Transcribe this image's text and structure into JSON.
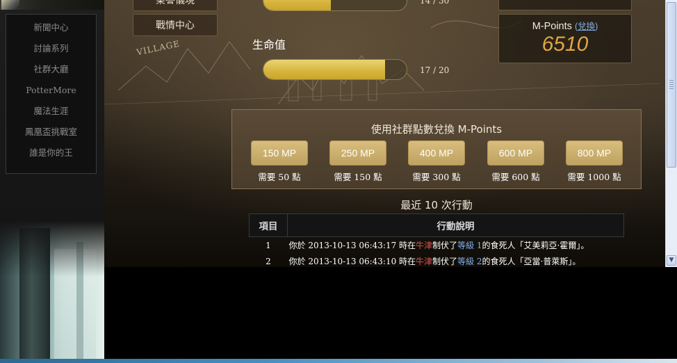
{
  "left_nav": {
    "items": [
      "新聞中心",
      "討論系列",
      "社群大廳",
      "PotterMore",
      "魔法生涯",
      "鳳凰盃挑戰室",
      "誰是你的王"
    ]
  },
  "buttons": {
    "top_partial": "榮譽儀現",
    "battle_center": "戰情中心"
  },
  "bars": {
    "top_text": "14 / 30",
    "top_fraction": 0.47,
    "life_label": "生命值",
    "life_text": "17 / 20",
    "life_fraction": 0.85
  },
  "mpoints": {
    "title": "M-Points",
    "link_open": "(",
    "link": "兌換",
    "link_close": ")",
    "value": "6510"
  },
  "exchange": {
    "title": "使用社群點數兌換 M-Points",
    "options": [
      {
        "label": "150 MP",
        "note": "需要 50 點"
      },
      {
        "label": "250 MP",
        "note": "需要 150 點"
      },
      {
        "label": "400 MP",
        "note": "需要 300 點"
      },
      {
        "label": "600 MP",
        "note": "需要 600 點"
      },
      {
        "label": "800 MP",
        "note": "需要 1000 點"
      }
    ]
  },
  "recent": {
    "title": "最近 10 次行動",
    "headers": [
      "項目",
      "行動說明"
    ],
    "rows": [
      {
        "idx": "1",
        "pre": "你於 2013-10-13 06:43:17 時在",
        "location": "牛津",
        "mid": "制伏了",
        "level": "等級 1",
        "post": "的食死人「艾美莉亞·霍爾」。"
      },
      {
        "idx": "2",
        "pre": "你於 2013-10-13 06:43:10 時在",
        "location": "牛津",
        "mid": "制伏了",
        "level": "等級 2",
        "post": "的食死人「亞當·普萊斯」。"
      }
    ]
  },
  "map_text": "VILLAGE",
  "colors": {
    "gold_bar": "#d6b43c",
    "mpoints_value": "#e0a545",
    "link": "#7fb0e6",
    "location": "#e05050",
    "level": "#7fb0e6"
  }
}
